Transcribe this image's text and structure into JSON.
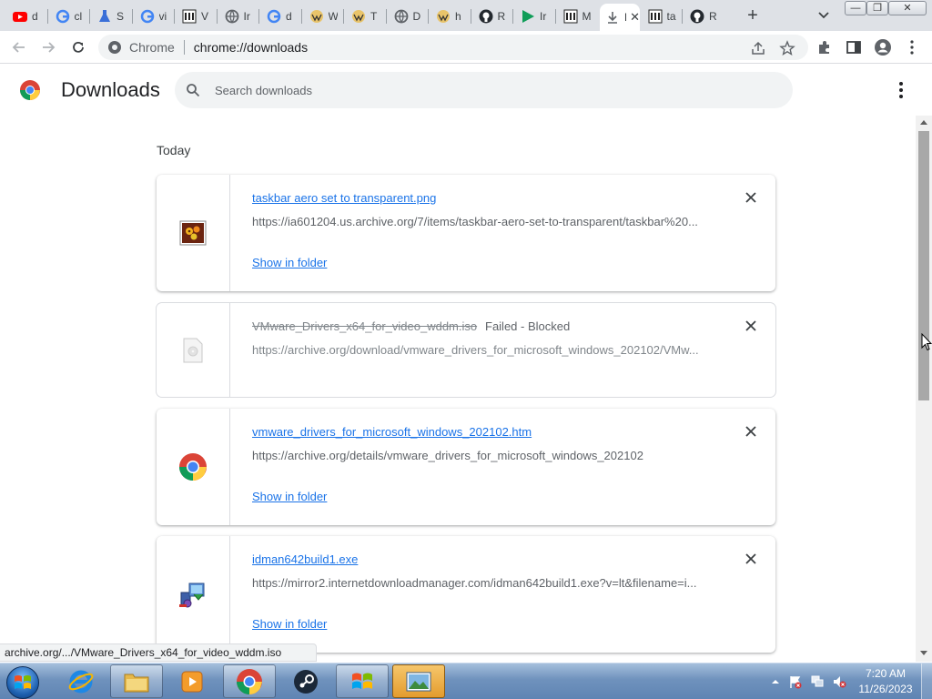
{
  "browser": {
    "tabs": [
      {
        "title": "d",
        "icon": "youtube-icon",
        "color": "#ff0000"
      },
      {
        "title": "cl",
        "icon": "google-icon",
        "color": "#4285f4"
      },
      {
        "title": "S",
        "icon": "flask-icon",
        "color": "#3a6fd8"
      },
      {
        "title": "vi",
        "icon": "google-icon",
        "color": "#4285f4"
      },
      {
        "title": "V",
        "icon": "archive-icon",
        "color": "#222222"
      },
      {
        "title": "Ir",
        "icon": "globe-icon",
        "color": "#5f6368"
      },
      {
        "title": "d",
        "icon": "google-icon",
        "color": "#4285f4"
      },
      {
        "title": "W",
        "icon": "wiki-icon",
        "color": "#d9a21b"
      },
      {
        "title": "T",
        "icon": "wiki-icon",
        "color": "#d9a21b"
      },
      {
        "title": "D",
        "icon": "globe-icon",
        "color": "#5f6368"
      },
      {
        "title": "h",
        "icon": "wiki-icon",
        "color": "#d9a21b"
      },
      {
        "title": "R",
        "icon": "github-icon",
        "color": "#24292f"
      },
      {
        "title": "Ir",
        "icon": "play-icon",
        "color": "#0f9d58"
      },
      {
        "title": "M",
        "icon": "archive-icon",
        "color": "#222222"
      },
      {
        "title": "D",
        "icon": "downloads-icon",
        "color": "#5f6368",
        "active": true
      },
      {
        "title": "ta",
        "icon": "archive-icon",
        "color": "#222222"
      },
      {
        "title": "R",
        "icon": "github-icon",
        "color": "#24292f"
      }
    ],
    "omnibox": {
      "chip_label": "Chrome",
      "url": "chrome://downloads"
    }
  },
  "downloads_page": {
    "title": "Downloads",
    "search_placeholder": "Search downloads",
    "section_heading": "Today",
    "show_in_folder_label": "Show in folder",
    "items": [
      {
        "file_name": "taskbar aero set to transparent.png",
        "url": "https://ia601204.us.archive.org/7/items/taskbar-aero-set-to-transparent/taskbar%20...",
        "status": "",
        "icon": "image-file-icon"
      },
      {
        "file_name": "VMware_Drivers_x64_for_video_wddm.iso",
        "url": "https://archive.org/download/vmware_drivers_for_microsoft_windows_202102/VMw...",
        "status": "Failed - Blocked",
        "icon": "generic-file-icon"
      },
      {
        "file_name": "vmware_drivers_for_microsoft_windows_202102.htm",
        "url": "https://archive.org/details/vmware_drivers_for_microsoft_windows_202102",
        "status": "",
        "icon": "chrome-file-icon"
      },
      {
        "file_name": "idman642build1.exe",
        "url": "https://mirror2.internetdownloadmanager.com/idman642build1.exe?v=lt&filename=i...",
        "status": "",
        "icon": "installer-file-icon"
      }
    ]
  },
  "status_bubble": "archive.org/.../VMware_Drivers_x64_for_video_wddm.iso",
  "taskbar": {
    "apps": [
      "internet-explorer",
      "file-explorer",
      "media-player",
      "chrome",
      "steam",
      "windows-update",
      "photo-viewer"
    ],
    "clock_time": "7:20 AM",
    "clock_date": "11/26/2023"
  },
  "colors": {
    "link_blue": "#1a73e8",
    "tabstrip_bg": "#dee1e6",
    "taskbar_blue": "#6f92bd"
  }
}
